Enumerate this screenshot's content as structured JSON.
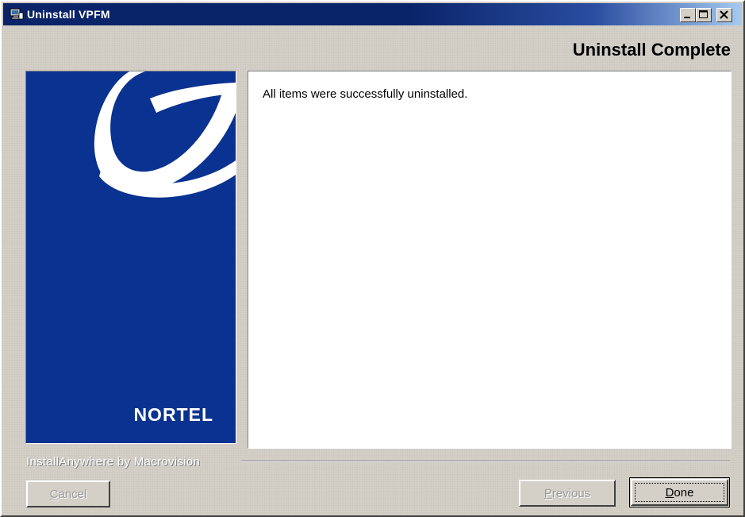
{
  "window": {
    "title": "Uninstall VPFM",
    "icon": "installer-icon",
    "controls": [
      "minimize",
      "maximize",
      "close"
    ]
  },
  "header": {
    "step_title": "Uninstall Complete"
  },
  "left_panel": {
    "brand": "NORTEL",
    "background_color": "#0a3290"
  },
  "content": {
    "message": "All items were successfully uninstalled."
  },
  "footer": {
    "vendor_label": "InstallAnywhere by Macrovision"
  },
  "buttons": {
    "cancel": {
      "label": "Cancel",
      "mnemonic": "C",
      "rest": "ancel",
      "enabled": false
    },
    "previous": {
      "label": "Previous",
      "mnemonic": "P",
      "rest": "revious",
      "enabled": false
    },
    "done": {
      "label": "Done",
      "mnemonic": "D",
      "rest": "one",
      "enabled": true
    }
  }
}
